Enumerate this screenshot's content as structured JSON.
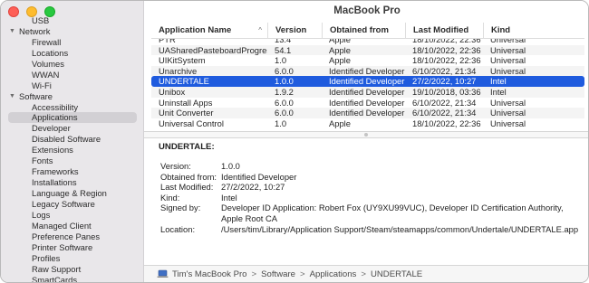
{
  "window": {
    "title": "MacBook Pro"
  },
  "sidebar": {
    "items": [
      {
        "label": "USB",
        "level": "child"
      },
      {
        "label": "Network",
        "level": "group"
      },
      {
        "label": "Firewall",
        "level": "child"
      },
      {
        "label": "Locations",
        "level": "child"
      },
      {
        "label": "Volumes",
        "level": "child"
      },
      {
        "label": "WWAN",
        "level": "child"
      },
      {
        "label": "Wi-Fi",
        "level": "child"
      },
      {
        "label": "Software",
        "level": "group"
      },
      {
        "label": "Accessibility",
        "level": "child"
      },
      {
        "label": "Applications",
        "level": "child",
        "selected": true
      },
      {
        "label": "Developer",
        "level": "child"
      },
      {
        "label": "Disabled Software",
        "level": "child"
      },
      {
        "label": "Extensions",
        "level": "child"
      },
      {
        "label": "Fonts",
        "level": "child"
      },
      {
        "label": "Frameworks",
        "level": "child"
      },
      {
        "label": "Installations",
        "level": "child"
      },
      {
        "label": "Language & Region",
        "level": "child"
      },
      {
        "label": "Legacy Software",
        "level": "child"
      },
      {
        "label": "Logs",
        "level": "child"
      },
      {
        "label": "Managed Client",
        "level": "child"
      },
      {
        "label": "Preference Panes",
        "level": "child"
      },
      {
        "label": "Printer Software",
        "level": "child"
      },
      {
        "label": "Profiles",
        "level": "child"
      },
      {
        "label": "Raw Support",
        "level": "child"
      },
      {
        "label": "SmartCards",
        "level": "child"
      }
    ]
  },
  "table": {
    "columns": [
      "Application Name",
      "Version",
      "Obtained from",
      "Last Modified",
      "Kind"
    ],
    "sort_arrow": "^",
    "rows": [
      [
        "PTR",
        "13.4",
        "Apple",
        "18/10/2022, 22:36",
        "Universal"
      ],
      [
        "UASharedPasteboardProgressUI",
        "54.1",
        "Apple",
        "18/10/2022, 22:36",
        "Universal"
      ],
      [
        "UIKitSystem",
        "1.0",
        "Apple",
        "18/10/2022, 22:36",
        "Universal"
      ],
      [
        "Unarchive",
        "6.0.0",
        "Identified Developer",
        "6/10/2022, 21:34",
        "Universal"
      ],
      [
        "UNDERTALE",
        "1.0.0",
        "Identified Developer",
        "27/2/2022, 10:27",
        "Intel"
      ],
      [
        "Unibox",
        "1.9.2",
        "Identified Developer",
        "19/10/2018, 03:36",
        "Intel"
      ],
      [
        "Uninstall Apps",
        "6.0.0",
        "Identified Developer",
        "6/10/2022, 21:34",
        "Universal"
      ],
      [
        "Unit Converter",
        "6.0.0",
        "Identified Developer",
        "6/10/2022, 21:34",
        "Universal"
      ],
      [
        "Universal Control",
        "1.0",
        "Apple",
        "18/10/2022, 22:36",
        "Universal"
      ]
    ],
    "selected_index": 4
  },
  "detail": {
    "title": "UNDERTALE:",
    "fields": [
      {
        "key": "Version:",
        "value": "1.0.0"
      },
      {
        "key": "Obtained from:",
        "value": "Identified Developer"
      },
      {
        "key": "Last Modified:",
        "value": "27/2/2022, 10:27"
      },
      {
        "key": "Kind:",
        "value": "Intel"
      },
      {
        "key": "Signed by:",
        "value": "Developer ID Application: Robert Fox (UY9XU99VUC), Developer ID Certification Authority, Apple Root CA"
      },
      {
        "key": "Location:",
        "value": "/Users/tim/Library/Application Support/Steam/steamapps/common/Undertale/UNDERTALE.app"
      }
    ]
  },
  "breadcrumb": {
    "icon": "laptop-icon",
    "separator": ">",
    "parts": [
      "Tim's MacBook Pro",
      "Software",
      "Applications",
      "UNDERTALE"
    ]
  },
  "colors": {
    "selection": "#1f5bde",
    "sidebar_bg": "#e9e7ea",
    "close": "#fe5f57",
    "minimize": "#febc2e",
    "zoom": "#28c840"
  }
}
